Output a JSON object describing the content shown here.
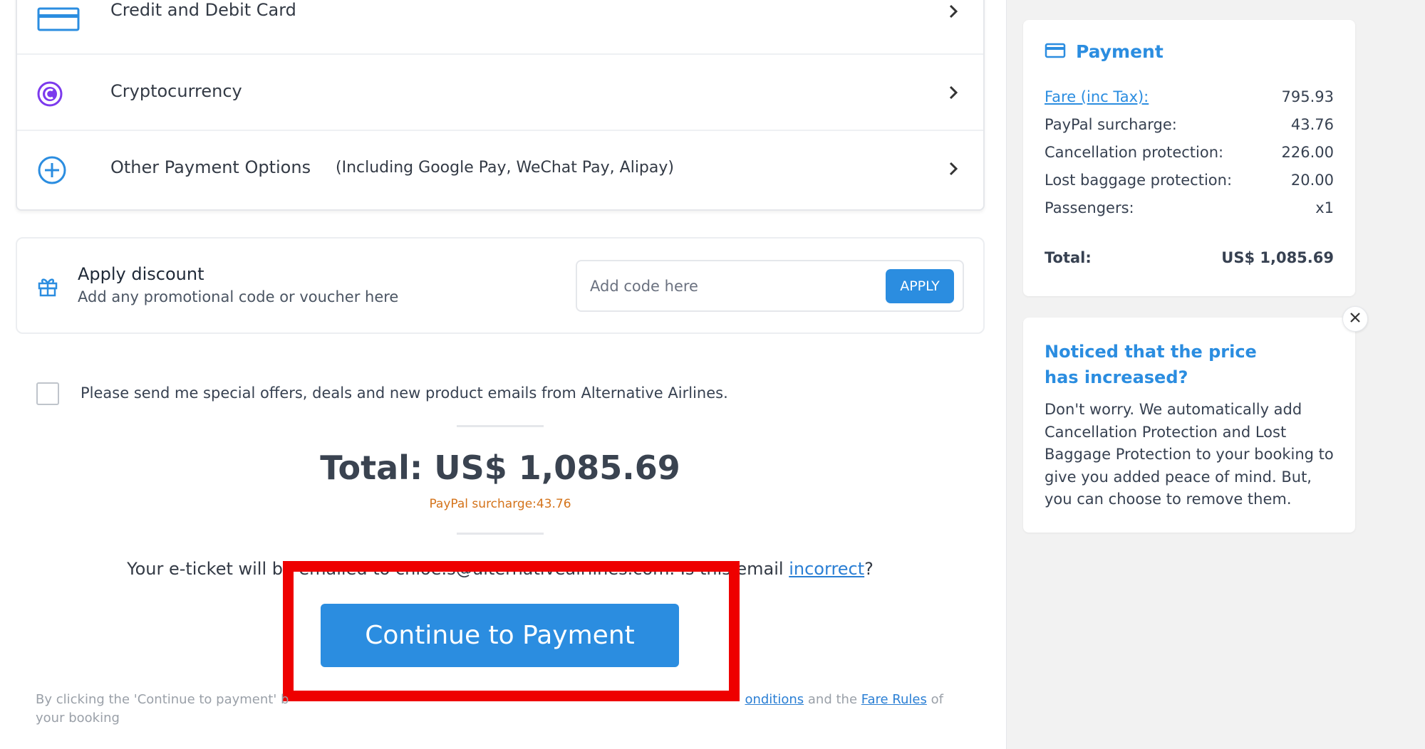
{
  "payment_options": [
    {
      "label": "Credit and Debit Card",
      "icon": "credit-card-icon"
    },
    {
      "label": "Cryptocurrency",
      "icon": "crypto-coin-icon"
    },
    {
      "label": "Other Payment Options",
      "note": "(Including Google Pay, WeChat Pay, Alipay)",
      "icon": "plus-circle-icon"
    }
  ],
  "discount": {
    "title": "Apply discount",
    "subtitle": "Add any promotional code or voucher here",
    "placeholder": "Add code here",
    "apply_label": "APPLY"
  },
  "optin": {
    "label": "Please send me special offers, deals and new product emails from Alternative Airlines.",
    "checked": false
  },
  "total": {
    "text": "Total: US$ 1,085.69",
    "surcharge": "PayPal surcharge:43.76"
  },
  "eticket": {
    "prefix": "Your e-ticket w",
    "email_text": "ill be emailed to chloe.s@alternativeairlines.com. Is this email",
    "suffix_gap": "n ",
    "link": "incorrect",
    "end": "?"
  },
  "continue_label": "Continue to Payment",
  "terms": {
    "prefix": "By clicking the 'Continue to payment' b",
    "link1": "onditions",
    "middle": " and the ",
    "link2": "Fare Rules",
    "suffix": " of your booking"
  },
  "summary": {
    "title": "Payment",
    "rows": [
      {
        "label": "Fare (inc Tax):",
        "value": "795.93"
      },
      {
        "label": "PayPal surcharge:",
        "value": "43.76"
      },
      {
        "label": "Cancellation protection:",
        "value": "226.00"
      },
      {
        "label": "Lost baggage protection:",
        "value": "20.00"
      },
      {
        "label": "Passengers:",
        "value": "x1"
      }
    ],
    "total_label": "Total:",
    "total_value": "US$ 1,085.69"
  },
  "notice": {
    "title": "Noticed that the price has increased?",
    "body": "Don't worry. We automatically add Cancellation Protection and Lost Baggage Protection to your booking to give you added peace of mind. But, you can choose to remove them."
  },
  "colors": {
    "accent": "#2b8de0",
    "highlight": "#ee0000",
    "surcharge": "#d4731a",
    "crypto": "#7c3aed"
  }
}
